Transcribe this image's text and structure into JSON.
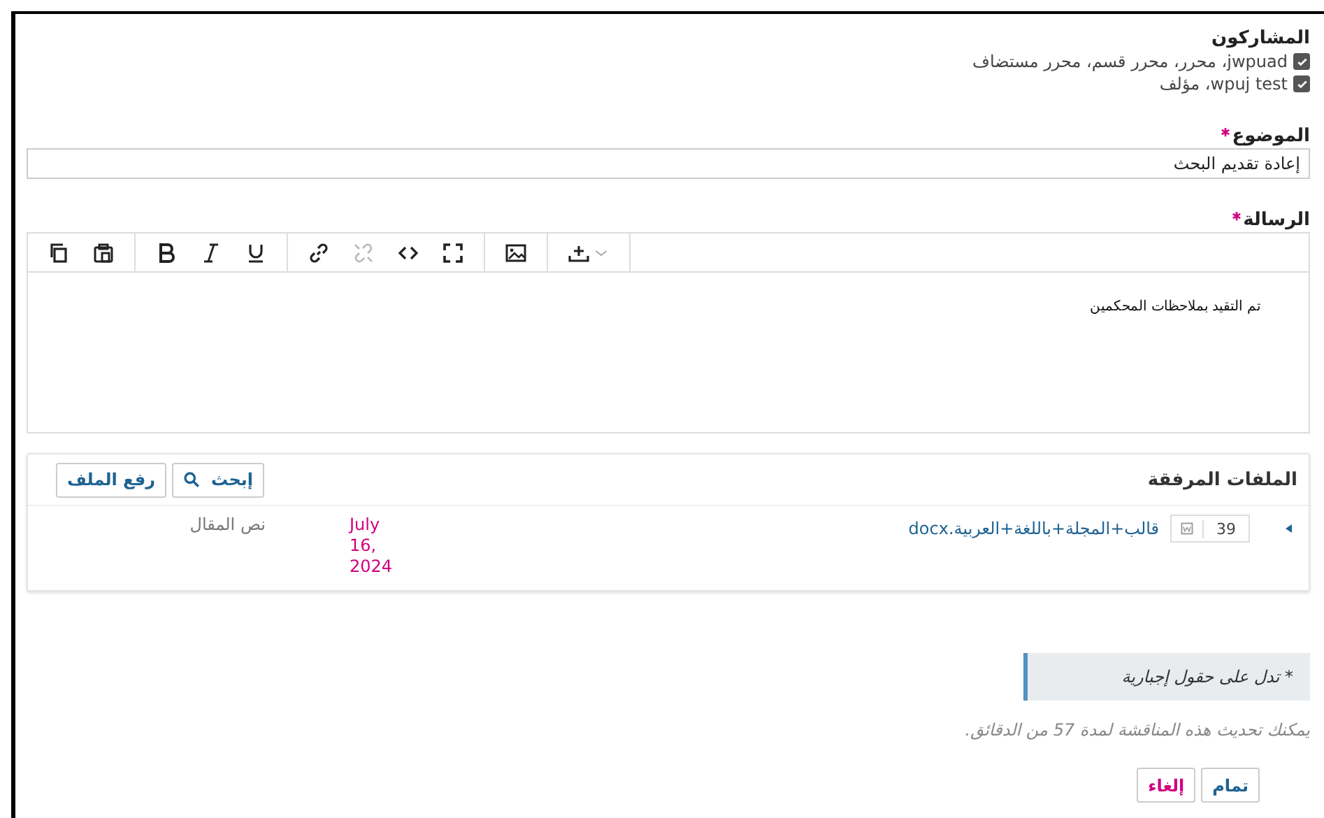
{
  "participants": {
    "label": "المشاركون",
    "items": [
      {
        "text": "jwpuad، محرر، محرر قسم، محرر مستضاف",
        "checked": true
      },
      {
        "text": "wpuj test، مؤلف",
        "checked": true
      }
    ]
  },
  "subject": {
    "label": "الموضوع",
    "required": true,
    "value": "إعادة تقديم البحث"
  },
  "message": {
    "label": "الرسالة",
    "required": true,
    "value": "تم التقيد بملاحظات المحكمين",
    "toolbar": [
      [
        {
          "kind": "copy",
          "disabled": false
        },
        {
          "kind": "paste",
          "disabled": false
        }
      ],
      [
        {
          "kind": "bold",
          "disabled": false
        },
        {
          "kind": "italic",
          "disabled": false
        },
        {
          "kind": "underline",
          "disabled": false
        }
      ],
      [
        {
          "kind": "link",
          "disabled": false
        },
        {
          "kind": "unlink",
          "disabled": true
        },
        {
          "kind": "code",
          "disabled": false
        },
        {
          "kind": "fullscreen",
          "disabled": false
        }
      ],
      [
        {
          "kind": "image",
          "disabled": false
        }
      ],
      [
        {
          "kind": "insert",
          "disabled": false
        }
      ]
    ]
  },
  "attachments": {
    "title": "الملفات المرفقة",
    "buttons": [
      {
        "kind": "search",
        "label": "إبحث"
      },
      {
        "kind": "upload",
        "label": "رفع الملف"
      }
    ],
    "rows": [
      {
        "expanded": false,
        "id": "39",
        "name": "قالب+المجلة+باللغة+العربية.docx",
        "date": "July 16, 2024",
        "type": "نص المقال"
      }
    ]
  },
  "note": "* تدل على حقول إجبارية",
  "timer_text": "يمكنك تحديث هذه المناقشة لمدة 57 من الدقائق.",
  "actions": [
    {
      "kind": "ok",
      "label": "تمام"
    },
    {
      "kind": "cancel",
      "label": "إلغاء"
    }
  ]
}
